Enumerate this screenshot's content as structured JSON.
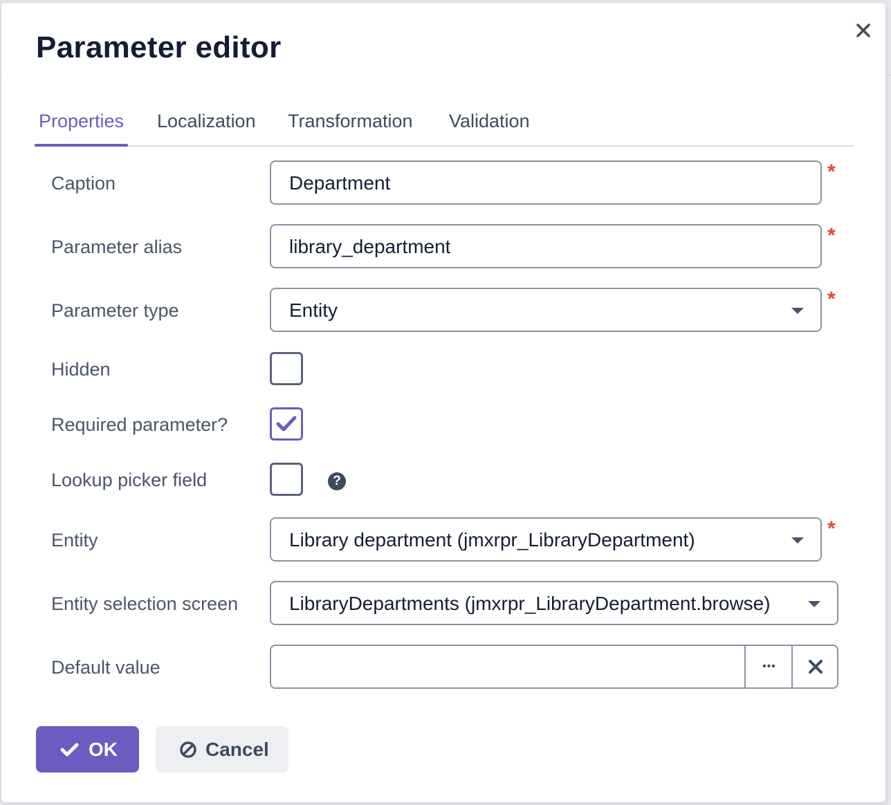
{
  "dialog": {
    "title": "Parameter editor",
    "close_icon": "close-icon"
  },
  "tabs": [
    {
      "label": "Properties",
      "active": true
    },
    {
      "label": "Localization",
      "active": false
    },
    {
      "label": "Transformation",
      "active": false
    },
    {
      "label": "Validation",
      "active": false
    }
  ],
  "form": {
    "caption": {
      "label": "Caption",
      "value": "Department",
      "required": true
    },
    "alias": {
      "label": "Parameter alias",
      "value": "library_department",
      "required": true
    },
    "type": {
      "label": "Parameter type",
      "value": "Entity",
      "required": true
    },
    "hidden": {
      "label": "Hidden",
      "checked": false
    },
    "required_param": {
      "label": "Required parameter?",
      "checked": true
    },
    "lookup": {
      "label": "Lookup picker field",
      "checked": false,
      "help": "?"
    },
    "entity": {
      "label": "Entity",
      "value": "Library department (jmxrpr_LibraryDepartment)",
      "required": true
    },
    "selection_screen": {
      "label": "Entity selection screen",
      "value": "LibraryDepartments (jmxrpr_LibraryDepartment.browse)"
    },
    "default_value": {
      "label": "Default value",
      "value": "",
      "picker_label": "•••"
    }
  },
  "required_marker": "*",
  "buttons": {
    "ok": "OK",
    "cancel": "Cancel"
  },
  "colors": {
    "accent": "#6a5cc0",
    "required": "#e0483e",
    "title": "#141d33"
  }
}
